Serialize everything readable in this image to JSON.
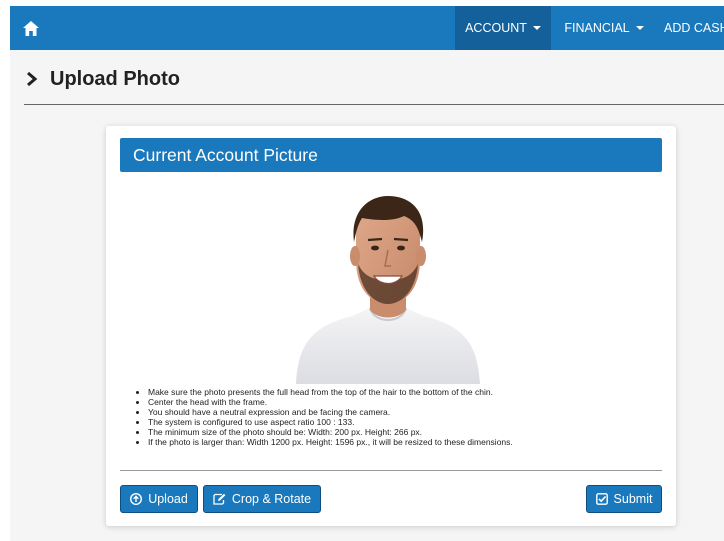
{
  "navbar": {
    "home_icon": "home-icon",
    "items": [
      {
        "label": "ACCOUNT",
        "active": true,
        "dropdown": true
      },
      {
        "label": "FINANCIAL",
        "active": false,
        "dropdown": true
      },
      {
        "label": "ADD CASH",
        "active": false,
        "dropdown": false
      }
    ],
    "colors": {
      "bar": "#1a78bd",
      "active": "#14609a"
    }
  },
  "page": {
    "title": "Upload Photo",
    "title_icon": "chevron-right-icon"
  },
  "card": {
    "title": "Current Account Picture",
    "photo_alt": "Current account photo",
    "instructions": [
      "Make sure the photo presents the full head from the top of the hair to the bottom of the chin.",
      "Center the head with the frame.",
      "You should have a neutral expression and be facing the camera.",
      "The system is configured to use aspect ratio 100 : 133.",
      "The minimum size of the photo should be: Width: 200 px. Height: 266 px.",
      "If the photo is larger than: Width 1200 px. Height: 1596 px., it will be resized to these dimensions."
    ],
    "buttons": {
      "upload": "Upload",
      "crop_rotate": "Crop & Rotate",
      "submit": "Submit"
    }
  }
}
